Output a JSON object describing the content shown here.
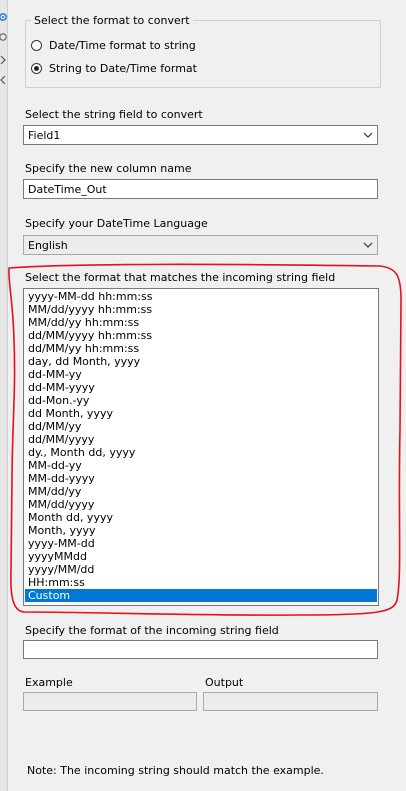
{
  "format_group": {
    "legend": "Select the format to convert",
    "options": [
      {
        "label": "Date/Time format to string",
        "checked": false
      },
      {
        "label": "String to Date/Time format",
        "checked": true
      }
    ]
  },
  "string_field": {
    "label": "Select the string field to convert",
    "value": "Field1"
  },
  "new_column": {
    "label": "Specify the new column name",
    "value": "DateTime_Out"
  },
  "language": {
    "label": "Specify your DateTime Language",
    "value": "English"
  },
  "format_list": {
    "label": "Select the format that matches the incoming string field",
    "items": [
      "yyyy-MM-dd hh:mm:ss",
      "MM/dd/yyyy hh:mm:ss",
      "MM/dd/yy hh:mm:ss",
      "dd/MM/yyyy hh:mm:ss",
      "dd/MM/yy hh:mm:ss",
      "day, dd Month, yyyy",
      "dd-MM-yy",
      "dd-MM-yyyy",
      "dd-Mon.-yy",
      "dd Month, yyyy",
      "dd/MM/yy",
      "dd/MM/yyyy",
      "dy., Month dd, yyyy",
      "MM-dd-yy",
      "MM-dd-yyyy",
      "MM/dd/yy",
      "MM/dd/yyyy",
      "Month dd, yyyy",
      "Month, yyyy",
      "yyyy-MM-dd",
      "yyyyMMdd",
      "yyyy/MM/dd",
      "HH:mm:ss",
      "Custom"
    ],
    "selected": "Custom"
  },
  "custom_format": {
    "label": "Specify the format of the incoming string field",
    "value": ""
  },
  "example": {
    "label": "Example",
    "value": ""
  },
  "output": {
    "label": "Output",
    "value": ""
  },
  "note": "Note: The incoming string should match the example.",
  "colors": {
    "selection": "#0078d7",
    "annotation": "#e8101a",
    "background": "#f0f0f0"
  },
  "icons": [
    "gear-icon",
    "help-icon",
    "chevron-right-icon",
    "chevron-left-icon",
    "chevron-down-icon"
  ]
}
